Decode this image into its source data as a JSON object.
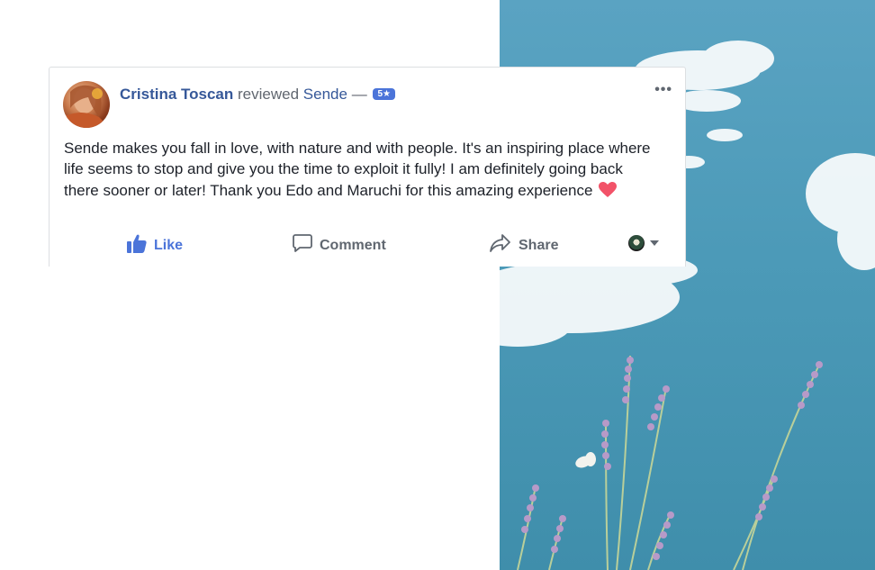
{
  "review": {
    "author": "Cristina Toscan",
    "verb": "reviewed",
    "page": "Sende",
    "dash": "—",
    "rating_badge": "5★",
    "text": "Sende makes you fall in love, with nature and with people. It's an inspiring place where life seems to stop and give you the time to exploit it fully! I am definitely going back there sooner or later! Thank you Edo and Maruchi for this amazing experience",
    "more_label": "•••"
  },
  "actions": {
    "like": "Like",
    "comment": "Comment",
    "share": "Share"
  },
  "icons": {
    "avatar": "avatar",
    "heart": "heart-emoji-icon",
    "like": "thumbs-up-icon",
    "comment": "comment-bubble-icon",
    "share": "share-arrow-icon",
    "audience": "page-avatar-icon",
    "caret": "caret-down-icon"
  },
  "colors": {
    "link": "#365899",
    "like_blue": "#4b74d9",
    "text": "#1d2129",
    "muted": "#606770",
    "heart": "#f25268"
  }
}
